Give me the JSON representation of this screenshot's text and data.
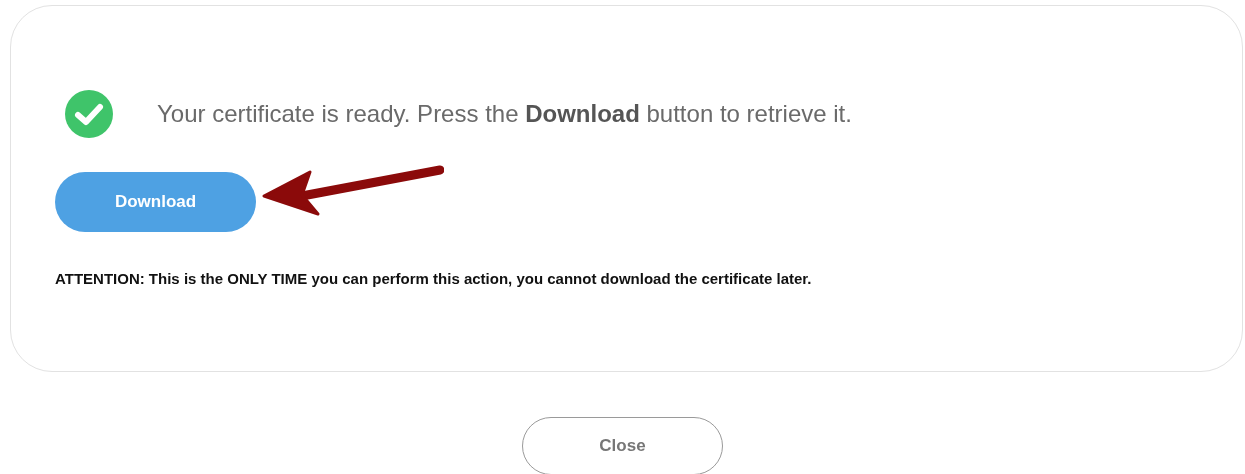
{
  "card": {
    "success": true,
    "message": "Your certificate is ready. Press the **Download** button to retrieve it.",
    "download_button": "Download",
    "attention": "ATTENTION: This is the ONLY TIME you can perform this action, you cannot download the certificate later."
  },
  "close_button": "Close"
}
